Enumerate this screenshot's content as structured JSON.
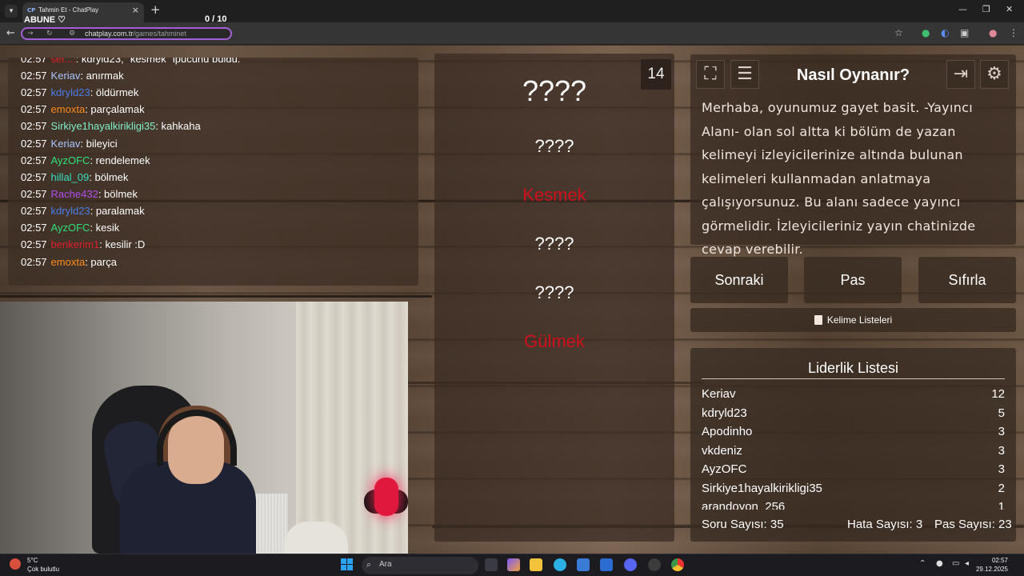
{
  "browser": {
    "tab_title": "Tahmin Et - ChatPlay",
    "tab_favicon": "CP",
    "url_host": "chatplay.com.tr",
    "url_path": "/games/tahminet"
  },
  "overlay": {
    "abune": "ABUNE ♡",
    "count": "0  / 10"
  },
  "chat": [
    {
      "time": "02:57",
      "user": "sel...:",
      "user_color": "#e0202a",
      "text": ": kdryld23, \"kesmek\" ipucunu buldu."
    },
    {
      "time": "02:57",
      "user": "Keriav",
      "user_color": "#a9c7ff",
      "text": ": anırmak"
    },
    {
      "time": "02:57",
      "user": "kdryld23",
      "user_color": "#4a7de8",
      "text": ": öldürmek"
    },
    {
      "time": "02:57",
      "user": "emoxta",
      "user_color": "#ff8c1a",
      "text": ": parçalamak"
    },
    {
      "time": "02:57",
      "user": "Sirkiye1hayalkirikligi35",
      "user_color": "#7ff0c8",
      "text": ": kahkaha"
    },
    {
      "time": "02:57",
      "user": "Keriav",
      "user_color": "#a9c7ff",
      "text": ": bileyici"
    },
    {
      "time": "02:57",
      "user": "AyzOFC",
      "user_color": "#2ee07a",
      "text": ": rendelemek"
    },
    {
      "time": "02:57",
      "user": "hillal_09",
      "user_color": "#35e0c0",
      "text": ": bölmek"
    },
    {
      "time": "02:57",
      "user": "Rache432",
      "user_color": "#b24cf0",
      "text": ": bölmek"
    },
    {
      "time": "02:57",
      "user": "kdryld23",
      "user_color": "#4a7de8",
      "text": ": paralamak"
    },
    {
      "time": "02:57",
      "user": "AyzOFC",
      "user_color": "#2ee07a",
      "text": ": kesik"
    },
    {
      "time": "02:57",
      "user": "benkerim1",
      "user_color": "#e0202a",
      "text": ": kesilir :D"
    },
    {
      "time": "02:57",
      "user": "emoxta",
      "user_color": "#ff8c1a",
      "text": ": parça"
    }
  ],
  "words": {
    "counter": "14",
    "items": [
      {
        "text": "????",
        "color": "#ffffff",
        "size": "big"
      },
      {
        "text": "????",
        "color": "#ffffff",
        "size": "normal"
      },
      {
        "text": "Kesmek",
        "color": "#d0101c",
        "size": "normal"
      },
      {
        "text": "????",
        "color": "#ffffff",
        "size": "normal"
      },
      {
        "text": "????",
        "color": "#ffffff",
        "size": "normal"
      },
      {
        "text": "Gülmek",
        "color": "#d0101c",
        "size": "normal"
      }
    ]
  },
  "how": {
    "title": "Nasıl Oynanır?",
    "text": "Merhaba, oyunumuz gayet basit. -Yayıncı Alanı- olan sol altta ki bölüm de yazan kelimeyi izleyicilerinize altında bulunan kelimeleri kullanmadan anlatmaya çalışıyorsunuz. Bu alanı sadece yayıncı görmelidir. İzleyicileriniz yayın chatinizde cevap verebilir."
  },
  "buttons": {
    "next": "Sonraki",
    "pass": "Pas",
    "reset": "Sıfırla"
  },
  "word_lists_label": "Kelime Listeleri",
  "leaderboard": {
    "title": "Liderlik Listesi",
    "rows": [
      {
        "name": "Keriav",
        "score": "12"
      },
      {
        "name": "kdryld23",
        "score": "5"
      },
      {
        "name": "Apodinho",
        "score": "3"
      },
      {
        "name": "vkdeniz",
        "score": "3"
      },
      {
        "name": "AyzOFC",
        "score": "3"
      },
      {
        "name": "Sirkiye1hayalkirikligi35",
        "score": "2"
      },
      {
        "name": "arandoyon_256",
        "score": "1"
      }
    ]
  },
  "stats": {
    "questions": "Soru Sayısı: 35",
    "errors": "Hata Sayısı: 3",
    "passes": "Pas Sayısı: 23"
  },
  "taskbar": {
    "temp": "5°C",
    "condition": "Çok bulutlu",
    "search_placeholder": "Ara",
    "time": "02:57",
    "date": "29.12.2025"
  }
}
